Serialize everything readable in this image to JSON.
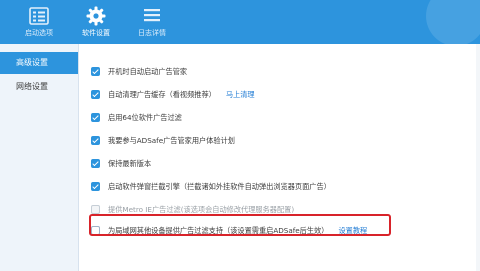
{
  "tabs": [
    {
      "label": "启动选项",
      "icon": "list-icon"
    },
    {
      "label": "软件设置",
      "icon": "gear-icon"
    },
    {
      "label": "日志详情",
      "icon": "log-icon"
    }
  ],
  "sidebar": {
    "items": [
      {
        "label": "高级设置"
      },
      {
        "label": "网络设置"
      }
    ]
  },
  "options": [
    {
      "label": "开机时自动启动广告管家",
      "checked": true
    },
    {
      "label": "自动清理广告缓存（看视频推荐）",
      "link": "马上清理",
      "checked": true
    },
    {
      "label": "启用64位软件广告过滤",
      "checked": true
    },
    {
      "label": "我要参与ADSafe广告管家用户体验计划",
      "checked": true
    },
    {
      "label": "保持最新版本",
      "checked": true
    },
    {
      "label": "启动软件弹窗拦截引擎（拦截诸如外挂软件自动弹出浏览器页面广告）",
      "checked": true
    },
    {
      "label": "提供Metro IE广告过滤(该选项会自动修改代理服务器配置)",
      "checked": false,
      "disabled": true
    },
    {
      "label": "为局域网其他设备提供广告过滤支持（该设置需重启ADSafe后生效）",
      "link": "设置教程",
      "checked": false
    }
  ],
  "colors": {
    "accent": "#2d94dd",
    "highlight_box": "#d8232a",
    "link": "#1f7bd4"
  }
}
